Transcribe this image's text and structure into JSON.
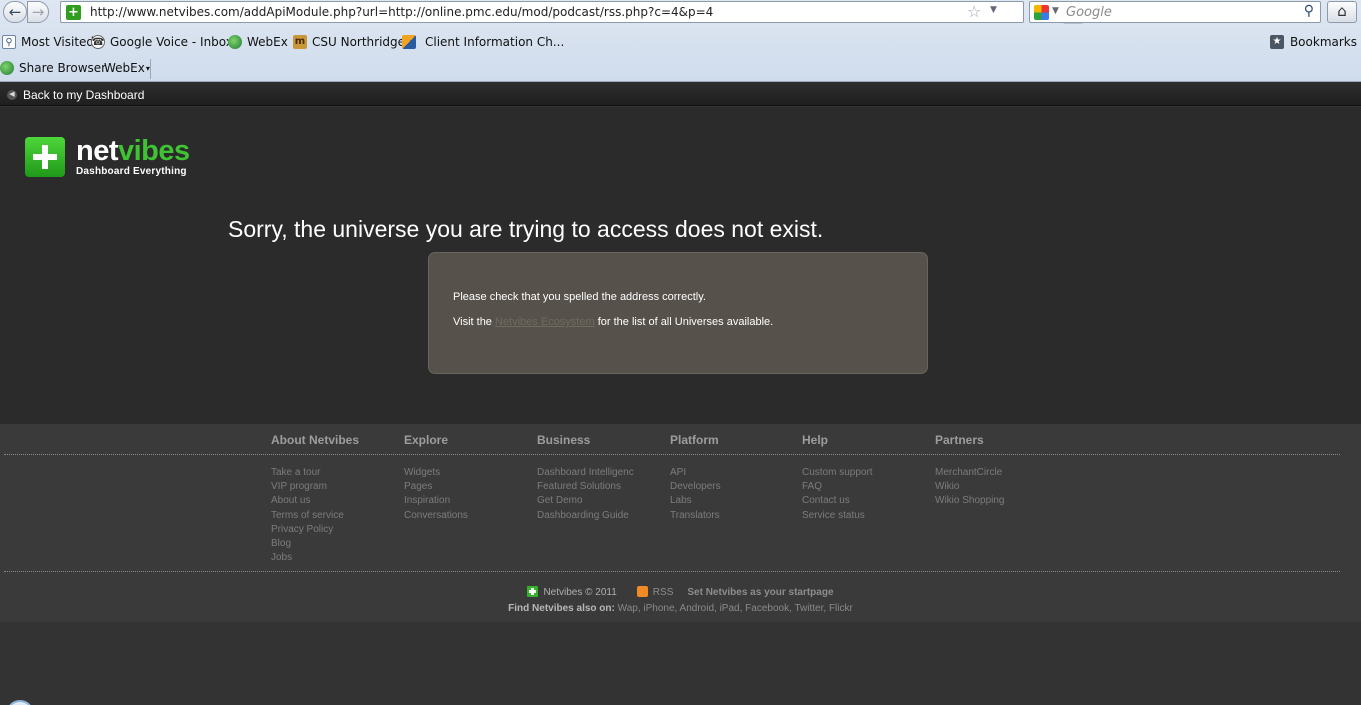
{
  "browser": {
    "url": "http://www.netvibes.com/addApiModule.php?url=http://online.pmc.edu/mod/podcast/rss.php?c=4&p=4",
    "search_placeholder": "Google",
    "bookmarks": [
      {
        "label": "Most Visited",
        "icon": "most-visited-icon"
      },
      {
        "label": "Google Voice - Inbox",
        "icon": "google-voice-icon"
      },
      {
        "label": "WebEx",
        "icon": "webex-icon"
      },
      {
        "label": "CSU Northridge",
        "icon": "csun-icon"
      },
      {
        "label": "Client Information Ch...",
        "icon": "client-info-icon"
      }
    ],
    "bookmarks_menu": "Bookmarks",
    "toolbar": {
      "share_browser": "Share Browser",
      "webex_menu": "WebEx"
    }
  },
  "topbar": {
    "back_label": "Back to my Dashboard"
  },
  "logo": {
    "word_a": "net",
    "word_b": "vibes",
    "tagline": "Dashboard Everything"
  },
  "error": {
    "title": "Sorry, the universe you are trying to access does not exist.",
    "line1": "Please check that you spelled the address correctly.",
    "line2_prefix": "Visit the",
    "line2_link": "Netvibes Ecosystem",
    "line2_suffix": "for the list of all Universes available."
  },
  "footer": {
    "columns": [
      {
        "heading": "About Netvibes",
        "links": [
          "Take a tour",
          "VIP program",
          "About us",
          "Terms of service",
          "Privacy Policy",
          "Blog",
          "Jobs"
        ]
      },
      {
        "heading": "Explore",
        "links": [
          "Widgets",
          "Pages",
          "Inspiration",
          "Conversations"
        ]
      },
      {
        "heading": "Business",
        "links": [
          "Dashboard Intelligenc",
          "Featured Solutions",
          "Get Demo",
          "Dashboarding Guide"
        ]
      },
      {
        "heading": "Platform",
        "links": [
          "API",
          "Developers",
          "Labs",
          "Translators"
        ]
      },
      {
        "heading": "Help",
        "links": [
          "Custom support",
          "FAQ",
          "Contact us",
          "Service status"
        ]
      },
      {
        "heading": "Partners",
        "links": [
          "MerchantCircle",
          "Wikio",
          "Wikio Shopping"
        ]
      }
    ],
    "copyright": "Netvibes © 2011",
    "rss": "RSS",
    "startpage": "Set Netvibes as your startpage",
    "find_label": "Find Netvibes also on:",
    "platforms": [
      "Wap",
      "iPhone",
      "Android",
      "iPad",
      "Facebook",
      "Twitter",
      "Flickr"
    ]
  }
}
